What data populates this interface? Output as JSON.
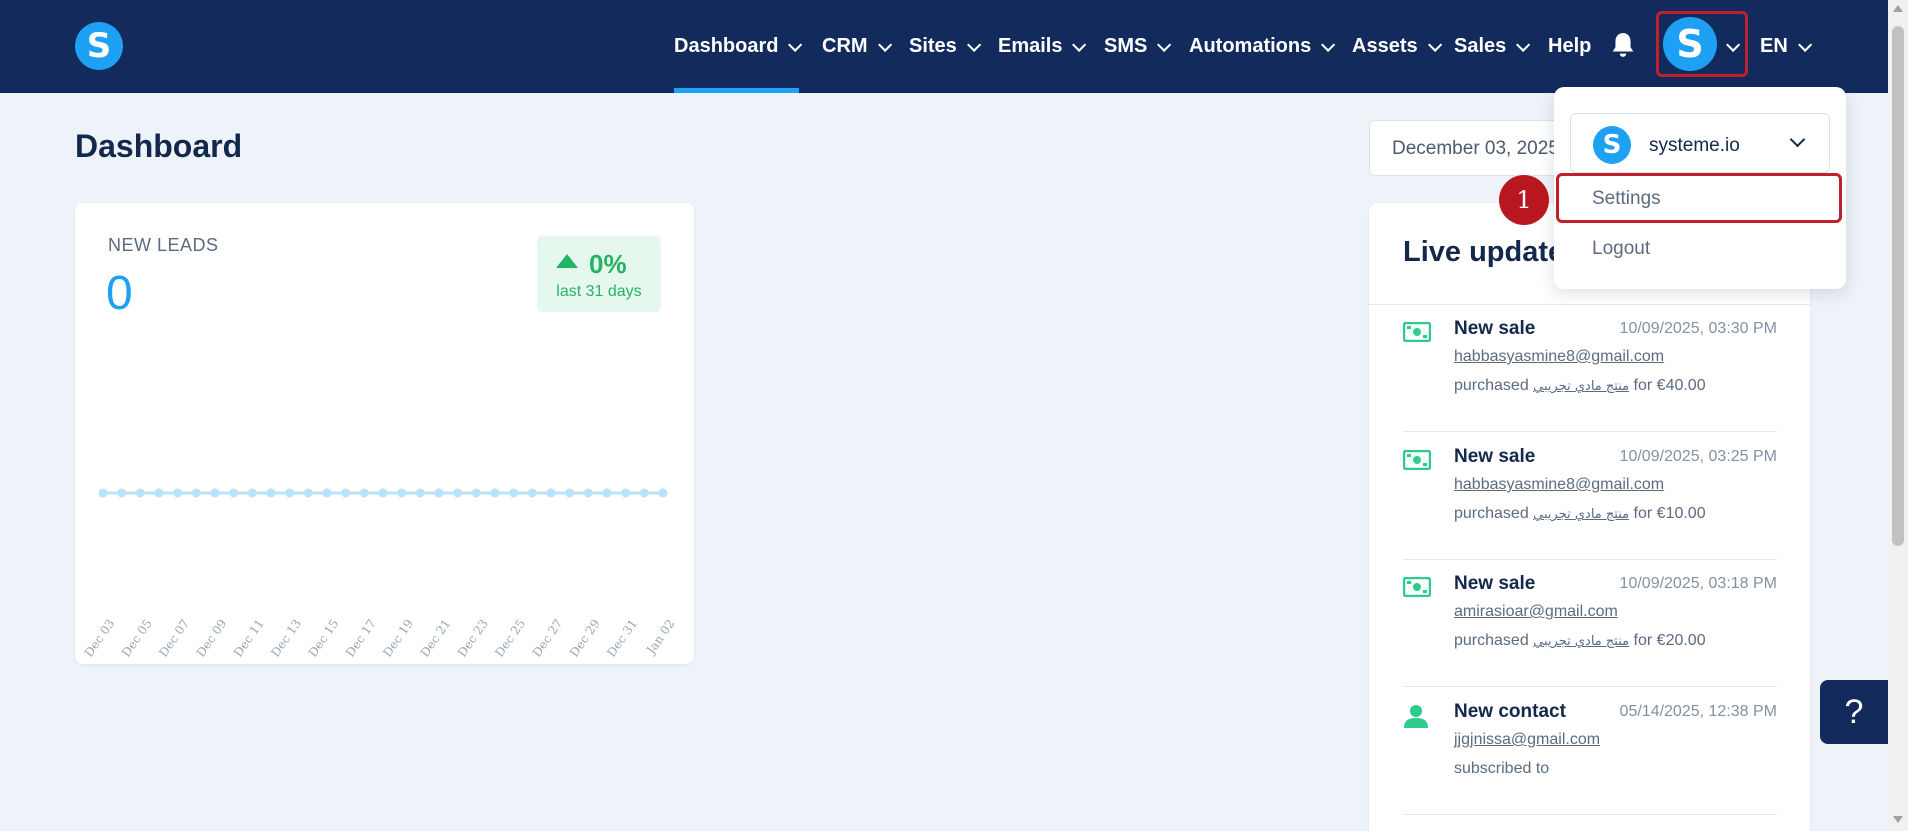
{
  "nav": {
    "logo": "S",
    "items": [
      {
        "label": "Dashboard",
        "dropdown": true
      },
      {
        "label": "CRM",
        "dropdown": true
      },
      {
        "label": "Sites",
        "dropdown": true
      },
      {
        "label": "Emails",
        "dropdown": true
      },
      {
        "label": "SMS",
        "dropdown": true
      },
      {
        "label": "Automations",
        "dropdown": true
      },
      {
        "label": "Assets",
        "dropdown": true
      },
      {
        "label": "Sales",
        "dropdown": true
      },
      {
        "label": "Help",
        "dropdown": false
      }
    ],
    "active_item": "Dashboard",
    "icons": [
      "bell-icon"
    ],
    "avatar": "S",
    "language": "EN"
  },
  "page": {
    "title": "Dashboard",
    "date_range": "December 03, 2025"
  },
  "leads_card": {
    "label": "NEW LEADS",
    "value": "0",
    "change_pct": "0%",
    "change_period": "last 31 days",
    "accent": "#1ea0f5",
    "positive_color": "#22b566"
  },
  "chart_data": {
    "type": "line",
    "title": "",
    "xlabel": "",
    "ylabel": "",
    "x": [
      "Dec 03",
      "Dec 04",
      "Dec 05",
      "Dec 06",
      "Dec 07",
      "Dec 08",
      "Dec 09",
      "Dec 10",
      "Dec 11",
      "Dec 12",
      "Dec 13",
      "Dec 14",
      "Dec 15",
      "Dec 16",
      "Dec 17",
      "Dec 18",
      "Dec 19",
      "Dec 20",
      "Dec 21",
      "Dec 22",
      "Dec 23",
      "Dec 24",
      "Dec 25",
      "Dec 26",
      "Dec 27",
      "Dec 28",
      "Dec 29",
      "Dec 30",
      "Dec 31",
      "Jan 01",
      "Jan 02"
    ],
    "tick_labels": [
      "Dec 03",
      "Dec 05",
      "Dec 07",
      "Dec 09",
      "Dec 11",
      "Dec 13",
      "Dec 15",
      "Dec 17",
      "Dec 19",
      "Dec 21",
      "Dec 23",
      "Dec 25",
      "Dec 27",
      "Dec 29",
      "Dec 31",
      "Jan 02"
    ],
    "series": [
      {
        "values": [
          0,
          0,
          0,
          0,
          0,
          0,
          0,
          0,
          0,
          0,
          0,
          0,
          0,
          0,
          0,
          0,
          0,
          0,
          0,
          0,
          0,
          0,
          0,
          0,
          0,
          0,
          0,
          0,
          0,
          0,
          0
        ],
        "color": "#b9e2fb"
      }
    ],
    "grid": false,
    "legend": "none"
  },
  "live": {
    "title": "Live update",
    "entries": [
      {
        "type": "New sale",
        "icon": "money-icon",
        "time": "10/09/2025, 03:30 PM",
        "email": "habbasyasmine8@gmail.com",
        "verb": "purchased",
        "product": "منتج مادي تجريبي",
        "suffix": "for €40.00"
      },
      {
        "type": "New sale",
        "icon": "money-icon",
        "time": "10/09/2025, 03:25 PM",
        "email": "habbasyasmine8@gmail.com",
        "verb": "purchased",
        "product": "منتج مادي تجريبي",
        "suffix": "for €10.00"
      },
      {
        "type": "New sale",
        "icon": "money-icon",
        "time": "10/09/2025, 03:18 PM",
        "email": "amirasioar@gmail.com",
        "verb": "purchased",
        "product": "منتج مادي تجريبي",
        "suffix": "for €20.00"
      },
      {
        "type": "New contact",
        "icon": "user-icon",
        "time": "05/14/2025, 12:38 PM",
        "email": "jjgjnissa@gmail.com",
        "verb": "subscribed to",
        "product": "",
        "suffix": ""
      }
    ]
  },
  "dropdown": {
    "account_logo": "S",
    "account_name": "systeme.io",
    "items": [
      "Settings",
      "Logout"
    ],
    "highlighted": "Settings",
    "step_number": "1",
    "highlight_color": "#c0202a"
  },
  "help_button": "?"
}
